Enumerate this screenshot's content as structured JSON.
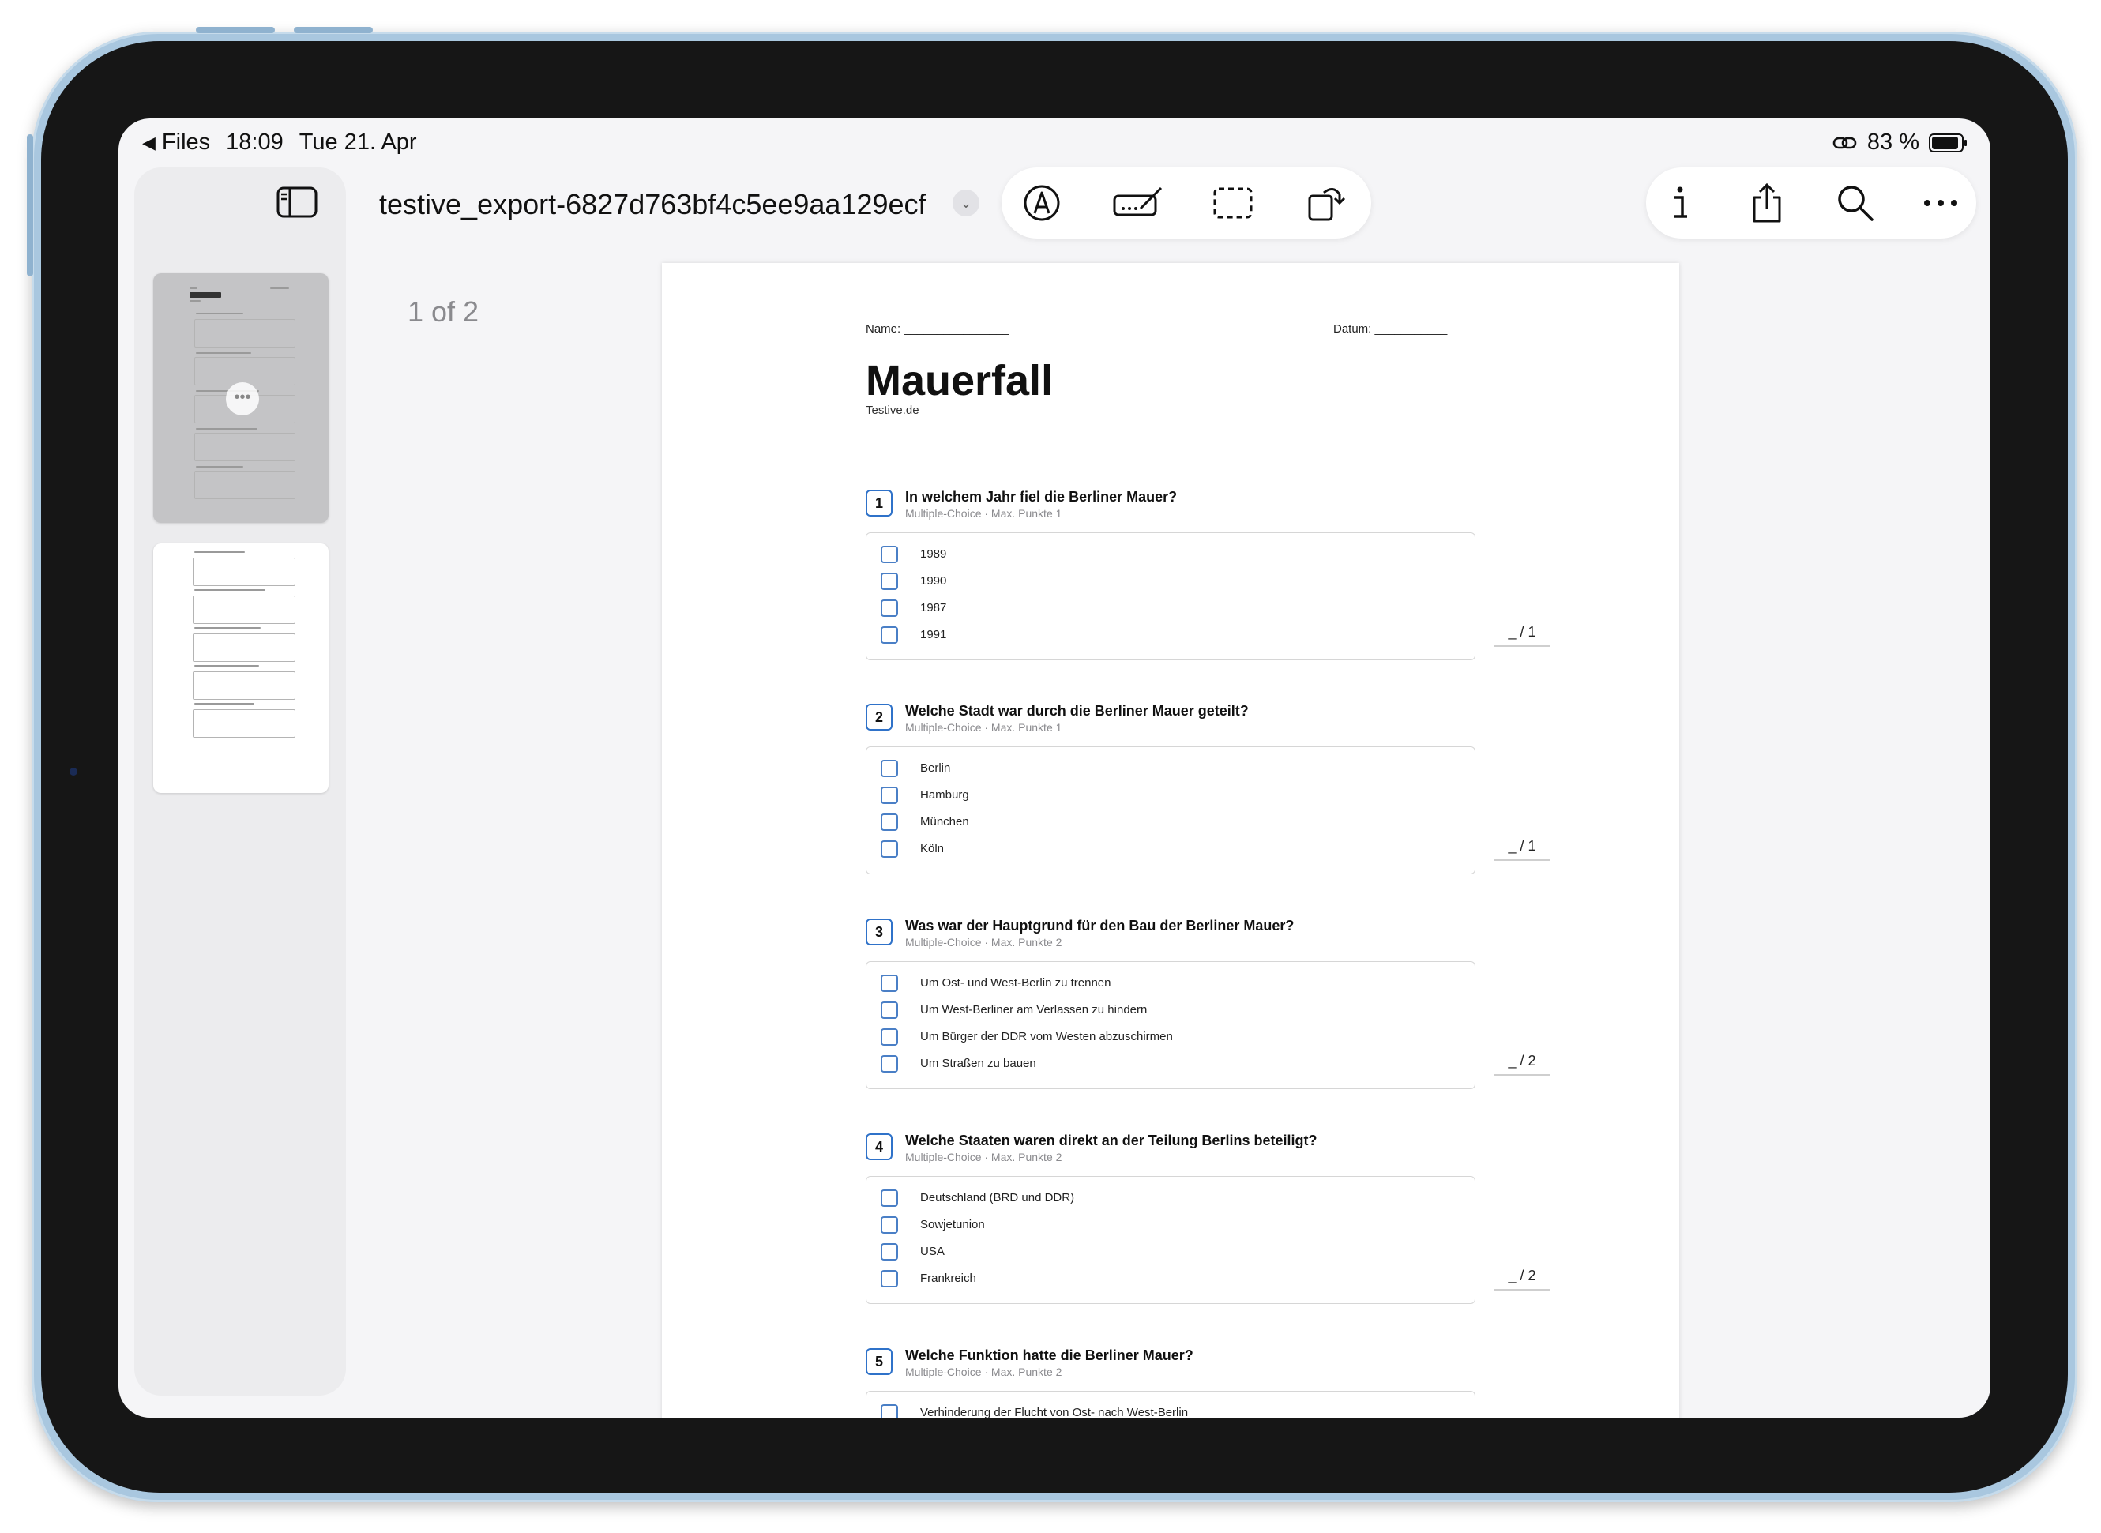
{
  "status_bar": {
    "back_label": "Files",
    "time": "18:09",
    "date": "Tue 21. Apr",
    "battery": "83 %"
  },
  "toolbar": {
    "document_title": "testive_export-6827d763bf4c5ee9aa129ecf"
  },
  "viewer": {
    "page_counter": "1 of 2",
    "thumbnails_count": 2,
    "selected_page": 1
  },
  "document": {
    "name_label": "Name: ________________",
    "date_label": "Datum: ___________",
    "title": "Mauerfall",
    "subtitle": "Testive.de",
    "questions": [
      {
        "number": "1",
        "text": "In welchem Jahr fiel die Berliner Mauer?",
        "meta": "Multiple-Choice · Max. Punkte 1",
        "options": [
          "1989",
          "1990",
          "1987",
          "1991"
        ],
        "score": "_ / 1"
      },
      {
        "number": "2",
        "text": "Welche Stadt war durch die Berliner Mauer geteilt?",
        "meta": "Multiple-Choice · Max. Punkte 1",
        "options": [
          "Berlin",
          "Hamburg",
          "München",
          "Köln"
        ],
        "score": "_ / 1"
      },
      {
        "number": "3",
        "text": "Was war der Hauptgrund für den Bau der Berliner Mauer?",
        "meta": "Multiple-Choice · Max. Punkte 2",
        "options": [
          "Um Ost- und West-Berlin zu trennen",
          "Um West-Berliner am Verlassen zu hindern",
          "Um Bürger der DDR vom Westen abzuschirmen",
          "Um Straßen zu bauen"
        ],
        "score": "_ / 2"
      },
      {
        "number": "4",
        "text": "Welche Staaten waren direkt an der Teilung Berlins beteiligt?",
        "meta": "Multiple-Choice · Max. Punkte 2",
        "options": [
          "Deutschland (BRD und DDR)",
          "Sowjetunion",
          "USA",
          "Frankreich"
        ],
        "score": "_ / 2"
      },
      {
        "number": "5",
        "text": "Welche Funktion hatte die Berliner Mauer?",
        "meta": "Multiple-Choice · Max. Punkte 2",
        "options": [
          "Verhinderung der Flucht von Ost- nach West-Berlin"
        ],
        "score": ""
      }
    ]
  },
  "icons": {
    "back": "back-arrow-icon",
    "link": "link-icon",
    "battery": "battery-icon",
    "sidebar": "sidebar-toggle-icon",
    "markup": "markup-pen-icon",
    "signature": "signature-icon",
    "select": "selection-icon",
    "rotate": "rotate-icon",
    "info": "info-icon",
    "share": "share-icon",
    "search": "search-icon",
    "more": "more-icon"
  },
  "colors": {
    "accent_blue": "#2f72c9",
    "screen_bg": "#f5f5f7",
    "device_frame": "#a9c7df"
  }
}
